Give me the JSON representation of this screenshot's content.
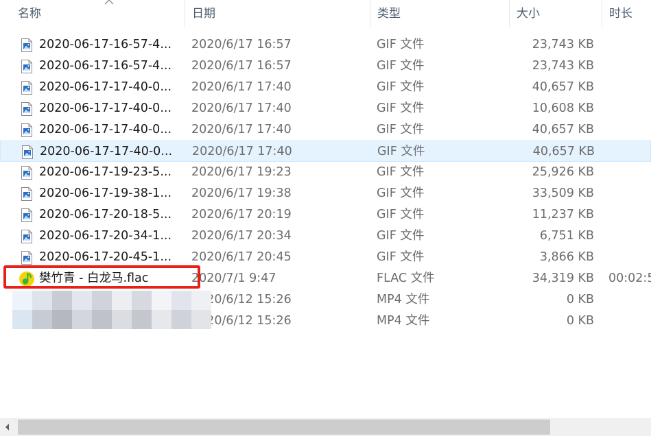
{
  "columns": {
    "name": "名称",
    "date": "日期",
    "type": "类型",
    "size": "大小",
    "duration": "时长"
  },
  "files": [
    {
      "name": "2020-06-17-16-57-4...",
      "date": "2020/6/17 16:57",
      "type": "GIF 文件",
      "size": "23,743 KB",
      "duration": "",
      "icon": "image-file-icon"
    },
    {
      "name": "2020-06-17-16-57-4...",
      "date": "2020/6/17 16:57",
      "type": "GIF 文件",
      "size": "23,743 KB",
      "duration": "",
      "icon": "image-file-icon"
    },
    {
      "name": "2020-06-17-17-40-0...",
      "date": "2020/6/17 17:40",
      "type": "GIF 文件",
      "size": "40,657 KB",
      "duration": "",
      "icon": "image-file-icon"
    },
    {
      "name": "2020-06-17-17-40-0...",
      "date": "2020/6/17 17:40",
      "type": "GIF 文件",
      "size": "10,608 KB",
      "duration": "",
      "icon": "image-file-icon"
    },
    {
      "name": "2020-06-17-17-40-0...",
      "date": "2020/6/17 17:40",
      "type": "GIF 文件",
      "size": "40,657 KB",
      "duration": "",
      "icon": "image-file-icon"
    },
    {
      "name": "2020-06-17-17-40-0...",
      "date": "2020/6/17 17:40",
      "type": "GIF 文件",
      "size": "40,657 KB",
      "duration": "",
      "icon": "image-file-icon",
      "selected": true
    },
    {
      "name": "2020-06-17-19-23-5...",
      "date": "2020/6/17 19:23",
      "type": "GIF 文件",
      "size": "25,926 KB",
      "duration": "",
      "icon": "image-file-icon"
    },
    {
      "name": "2020-06-17-19-38-1...",
      "date": "2020/6/17 19:38",
      "type": "GIF 文件",
      "size": "33,509 KB",
      "duration": "",
      "icon": "image-file-icon"
    },
    {
      "name": "2020-06-17-20-18-5...",
      "date": "2020/6/17 20:19",
      "type": "GIF 文件",
      "size": "11,237 KB",
      "duration": "",
      "icon": "image-file-icon"
    },
    {
      "name": "2020-06-17-20-34-1...",
      "date": "2020/6/17 20:34",
      "type": "GIF 文件",
      "size": "6,751 KB",
      "duration": "",
      "icon": "image-file-icon"
    },
    {
      "name": "2020-06-17-20-45-1...",
      "date": "2020/6/17 20:45",
      "type": "GIF 文件",
      "size": "3,866 KB",
      "duration": "",
      "icon": "image-file-icon"
    },
    {
      "name": "樊竹青 - 白龙马.flac",
      "date": "2020/7/1 9:47",
      "type": "FLAC 文件",
      "size": "34,319 KB",
      "duration": "00:02:5",
      "icon": "music-file-icon"
    },
    {
      "name": "",
      "date": "2020/6/12 15:26",
      "type": "MP4 文件",
      "size": "0 KB",
      "duration": "",
      "icon": ""
    },
    {
      "name": "",
      "date": "2020/6/12 15:26",
      "type": "MP4 文件",
      "size": "0 KB",
      "duration": "",
      "icon": ""
    }
  ],
  "colors": {
    "selected_background": "#e5f3ff",
    "highlight_border": "#e8201b",
    "header_text": "#4d5b6e",
    "music_icon_yellow": "#f6d20a",
    "music_icon_green": "#2fb546"
  }
}
